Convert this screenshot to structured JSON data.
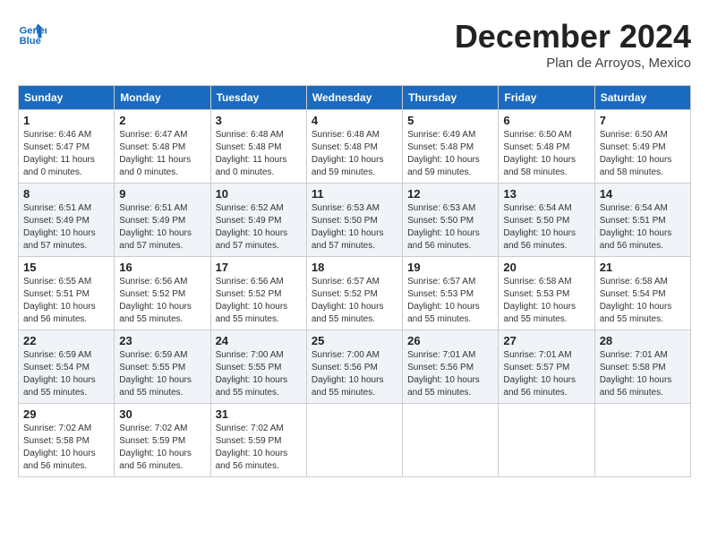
{
  "header": {
    "logo_line1": "General",
    "logo_line2": "Blue",
    "month": "December 2024",
    "location": "Plan de Arroyos, Mexico"
  },
  "days_of_week": [
    "Sunday",
    "Monday",
    "Tuesday",
    "Wednesday",
    "Thursday",
    "Friday",
    "Saturday"
  ],
  "weeks": [
    [
      {
        "day": 1,
        "info": "Sunrise: 6:46 AM\nSunset: 5:47 PM\nDaylight: 11 hours\nand 0 minutes."
      },
      {
        "day": 2,
        "info": "Sunrise: 6:47 AM\nSunset: 5:48 PM\nDaylight: 11 hours\nand 0 minutes."
      },
      {
        "day": 3,
        "info": "Sunrise: 6:48 AM\nSunset: 5:48 PM\nDaylight: 11 hours\nand 0 minutes."
      },
      {
        "day": 4,
        "info": "Sunrise: 6:48 AM\nSunset: 5:48 PM\nDaylight: 10 hours\nand 59 minutes."
      },
      {
        "day": 5,
        "info": "Sunrise: 6:49 AM\nSunset: 5:48 PM\nDaylight: 10 hours\nand 59 minutes."
      },
      {
        "day": 6,
        "info": "Sunrise: 6:50 AM\nSunset: 5:48 PM\nDaylight: 10 hours\nand 58 minutes."
      },
      {
        "day": 7,
        "info": "Sunrise: 6:50 AM\nSunset: 5:49 PM\nDaylight: 10 hours\nand 58 minutes."
      }
    ],
    [
      {
        "day": 8,
        "info": "Sunrise: 6:51 AM\nSunset: 5:49 PM\nDaylight: 10 hours\nand 57 minutes."
      },
      {
        "day": 9,
        "info": "Sunrise: 6:51 AM\nSunset: 5:49 PM\nDaylight: 10 hours\nand 57 minutes."
      },
      {
        "day": 10,
        "info": "Sunrise: 6:52 AM\nSunset: 5:49 PM\nDaylight: 10 hours\nand 57 minutes."
      },
      {
        "day": 11,
        "info": "Sunrise: 6:53 AM\nSunset: 5:50 PM\nDaylight: 10 hours\nand 57 minutes."
      },
      {
        "day": 12,
        "info": "Sunrise: 6:53 AM\nSunset: 5:50 PM\nDaylight: 10 hours\nand 56 minutes."
      },
      {
        "day": 13,
        "info": "Sunrise: 6:54 AM\nSunset: 5:50 PM\nDaylight: 10 hours\nand 56 minutes."
      },
      {
        "day": 14,
        "info": "Sunrise: 6:54 AM\nSunset: 5:51 PM\nDaylight: 10 hours\nand 56 minutes."
      }
    ],
    [
      {
        "day": 15,
        "info": "Sunrise: 6:55 AM\nSunset: 5:51 PM\nDaylight: 10 hours\nand 56 minutes."
      },
      {
        "day": 16,
        "info": "Sunrise: 6:56 AM\nSunset: 5:52 PM\nDaylight: 10 hours\nand 55 minutes."
      },
      {
        "day": 17,
        "info": "Sunrise: 6:56 AM\nSunset: 5:52 PM\nDaylight: 10 hours\nand 55 minutes."
      },
      {
        "day": 18,
        "info": "Sunrise: 6:57 AM\nSunset: 5:52 PM\nDaylight: 10 hours\nand 55 minutes."
      },
      {
        "day": 19,
        "info": "Sunrise: 6:57 AM\nSunset: 5:53 PM\nDaylight: 10 hours\nand 55 minutes."
      },
      {
        "day": 20,
        "info": "Sunrise: 6:58 AM\nSunset: 5:53 PM\nDaylight: 10 hours\nand 55 minutes."
      },
      {
        "day": 21,
        "info": "Sunrise: 6:58 AM\nSunset: 5:54 PM\nDaylight: 10 hours\nand 55 minutes."
      }
    ],
    [
      {
        "day": 22,
        "info": "Sunrise: 6:59 AM\nSunset: 5:54 PM\nDaylight: 10 hours\nand 55 minutes."
      },
      {
        "day": 23,
        "info": "Sunrise: 6:59 AM\nSunset: 5:55 PM\nDaylight: 10 hours\nand 55 minutes."
      },
      {
        "day": 24,
        "info": "Sunrise: 7:00 AM\nSunset: 5:55 PM\nDaylight: 10 hours\nand 55 minutes."
      },
      {
        "day": 25,
        "info": "Sunrise: 7:00 AM\nSunset: 5:56 PM\nDaylight: 10 hours\nand 55 minutes."
      },
      {
        "day": 26,
        "info": "Sunrise: 7:01 AM\nSunset: 5:56 PM\nDaylight: 10 hours\nand 55 minutes."
      },
      {
        "day": 27,
        "info": "Sunrise: 7:01 AM\nSunset: 5:57 PM\nDaylight: 10 hours\nand 56 minutes."
      },
      {
        "day": 28,
        "info": "Sunrise: 7:01 AM\nSunset: 5:58 PM\nDaylight: 10 hours\nand 56 minutes."
      }
    ],
    [
      {
        "day": 29,
        "info": "Sunrise: 7:02 AM\nSunset: 5:58 PM\nDaylight: 10 hours\nand 56 minutes."
      },
      {
        "day": 30,
        "info": "Sunrise: 7:02 AM\nSunset: 5:59 PM\nDaylight: 10 hours\nand 56 minutes."
      },
      {
        "day": 31,
        "info": "Sunrise: 7:02 AM\nSunset: 5:59 PM\nDaylight: 10 hours\nand 56 minutes."
      },
      null,
      null,
      null,
      null
    ]
  ]
}
